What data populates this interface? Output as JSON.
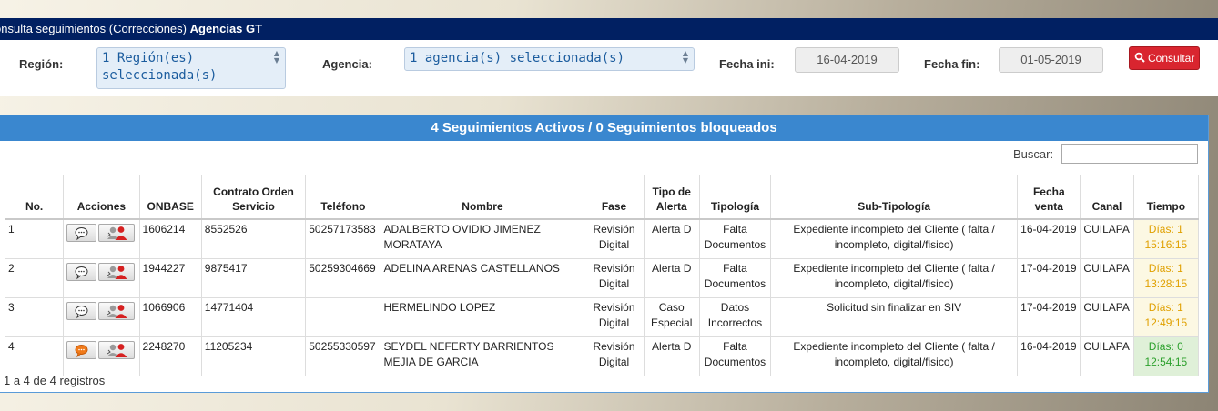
{
  "header": {
    "title_prefix": "onsulta seguimientos (Correcciones)",
    "title_strong": "Agencias GT"
  },
  "filters": {
    "region_label": "Región:",
    "region_value_line1": "1 Región(es)",
    "region_value_line2": "seleccionada(s)",
    "agencia_label": "Agencia:",
    "agencia_value": "1 agencia(s) seleccionada(s)",
    "fecha_ini_label": "Fecha ini:",
    "fecha_ini_value": "16-04-2019",
    "fecha_fin_label": "Fecha fin:",
    "fecha_fin_value": "01-05-2019",
    "consultar_label": "Consultar"
  },
  "panel": {
    "title": "4 Seguimientos Activos / 0 Seguimientos bloqueados",
    "search_label": "Buscar:",
    "search_value": "",
    "info": "1 a 4 de 4 registros"
  },
  "table": {
    "headers": [
      "No.",
      "Acciones",
      "ONBASE",
      "Contrato Orden Servicio",
      "Teléfono",
      "Nombre",
      "Fase",
      "Tipo de Alerta",
      "Tipología",
      "Sub-Tipología",
      "Fecha venta",
      "Canal",
      "Tiempo"
    ],
    "rows": [
      {
        "no": "1",
        "onbase": "1606214",
        "contrato": "8552526",
        "telefono": "50257173583",
        "nombre": "ADALBERTO OVIDIO JIMENEZ MORATAYA",
        "fase": "Revisión Digital",
        "alerta": "Alerta D",
        "tipologia": "Falta Documentos",
        "subtipologia": "Expediente incompleto del Cliente ( falta / incompleto, digital/fisico)",
        "fecha": "16-04-2019",
        "canal": "CUILAPA",
        "tiempo1": "Días: 1",
        "tiempo2": "15:16:15",
        "status": "yellow",
        "chat_active": false
      },
      {
        "no": "2",
        "onbase": "1944227",
        "contrato": "9875417",
        "telefono": "50259304669",
        "nombre": "ADELINA ARENAS CASTELLANOS",
        "fase": "Revisión Digital",
        "alerta": "Alerta D",
        "tipologia": "Falta Documentos",
        "subtipologia": "Expediente incompleto del Cliente ( falta / incompleto, digital/fisico)",
        "fecha": "17-04-2019",
        "canal": "CUILAPA",
        "tiempo1": "Días: 1",
        "tiempo2": "13:28:15",
        "status": "yellow",
        "chat_active": false
      },
      {
        "no": "3",
        "onbase": "1066906",
        "contrato": "14771404",
        "telefono": "",
        "nombre": "HERMELINDO LOPEZ",
        "fase": "Revisión Digital",
        "alerta": "Caso Especial",
        "tipologia": "Datos Incorrectos",
        "subtipologia": "Solicitud sin finalizar en SIV",
        "fecha": "17-04-2019",
        "canal": "CUILAPA",
        "tiempo1": "Días: 1",
        "tiempo2": "12:49:15",
        "status": "yellow",
        "chat_active": false
      },
      {
        "no": "4",
        "onbase": "2248270",
        "contrato": "11205234",
        "telefono": "50255330597",
        "nombre": "SEYDEL NEFERTY BARRIENTOS MEJIA DE GARCIA",
        "fase": "Revisión Digital",
        "alerta": "Alerta D",
        "tipologia": "Falta Documentos",
        "subtipologia": "Expediente incompleto del Cliente ( falta / incompleto, digital/fisico)",
        "fecha": "16-04-2019",
        "canal": "CUILAPA",
        "tiempo1": "Días: 0",
        "tiempo2": "12:54:15",
        "status": "green",
        "chat_active": true
      }
    ]
  },
  "icons": {
    "chat": "speech-bubble-icon",
    "user": "user-assign-icon",
    "search": "search-icon",
    "select_arrows": "select-arrows-icon"
  },
  "colors": {
    "title_bar": "#012062",
    "panel_header": "#3a87cf",
    "consultar_button": "#d9252f",
    "time_warning_bg": "#fcf8e3",
    "time_warning_text": "#e0a000",
    "time_ok_bg": "#dff0d8",
    "time_ok_text": "#2ca02c",
    "chat_active": "#f07a1a"
  }
}
